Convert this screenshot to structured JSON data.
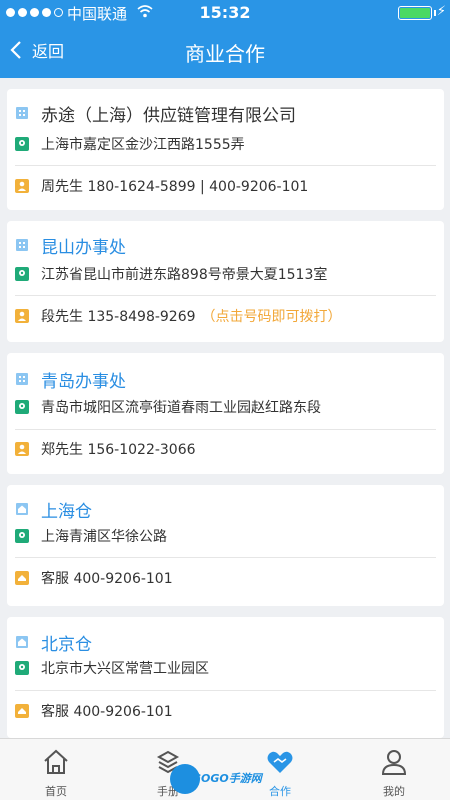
{
  "status": {
    "carrier": "中国联通",
    "time": "15:32"
  },
  "nav": {
    "back_label": "返回",
    "title": "商业合作"
  },
  "cards": [
    {
      "name": "赤途（上海）供应链管理有限公司",
      "address": "上海市嘉定区金沙江西路1555弄",
      "contact": "周先生  180-1624-5899 | 400-9206-101",
      "hint": ""
    },
    {
      "name": "昆山办事处",
      "address": "江苏省昆山市前进东路898号帝景大夏1513室",
      "contact": "段先生  135-8498-9269",
      "hint": "（点击号码即可拨打）"
    },
    {
      "name": "青岛办事处",
      "address": "青岛市城阳区流亭街道春雨工业园赵红路东段",
      "contact": "郑先生  156-1022-3066",
      "hint": ""
    },
    {
      "name": "上海仓",
      "address": "上海青浦区华徐公路",
      "contact": "客服  400-9206-101",
      "hint": ""
    },
    {
      "name": "北京仓",
      "address": "北京市大兴区常营工业园区",
      "contact": "客服  400-9206-101",
      "hint": ""
    }
  ],
  "tabs": [
    {
      "label": "首页",
      "icon": "home-icon"
    },
    {
      "label": "手册",
      "icon": "handbook-icon"
    },
    {
      "label": "合作",
      "icon": "handshake-icon"
    },
    {
      "label": "我的",
      "icon": "profile-icon"
    }
  ],
  "watermark": {
    "text": "GOGO手游网"
  },
  "colors": {
    "primary": "#2a95e6",
    "hint": "#f2a83a",
    "location": "#1faa78",
    "person": "#f2b13a",
    "building": "#8cc6f2"
  }
}
